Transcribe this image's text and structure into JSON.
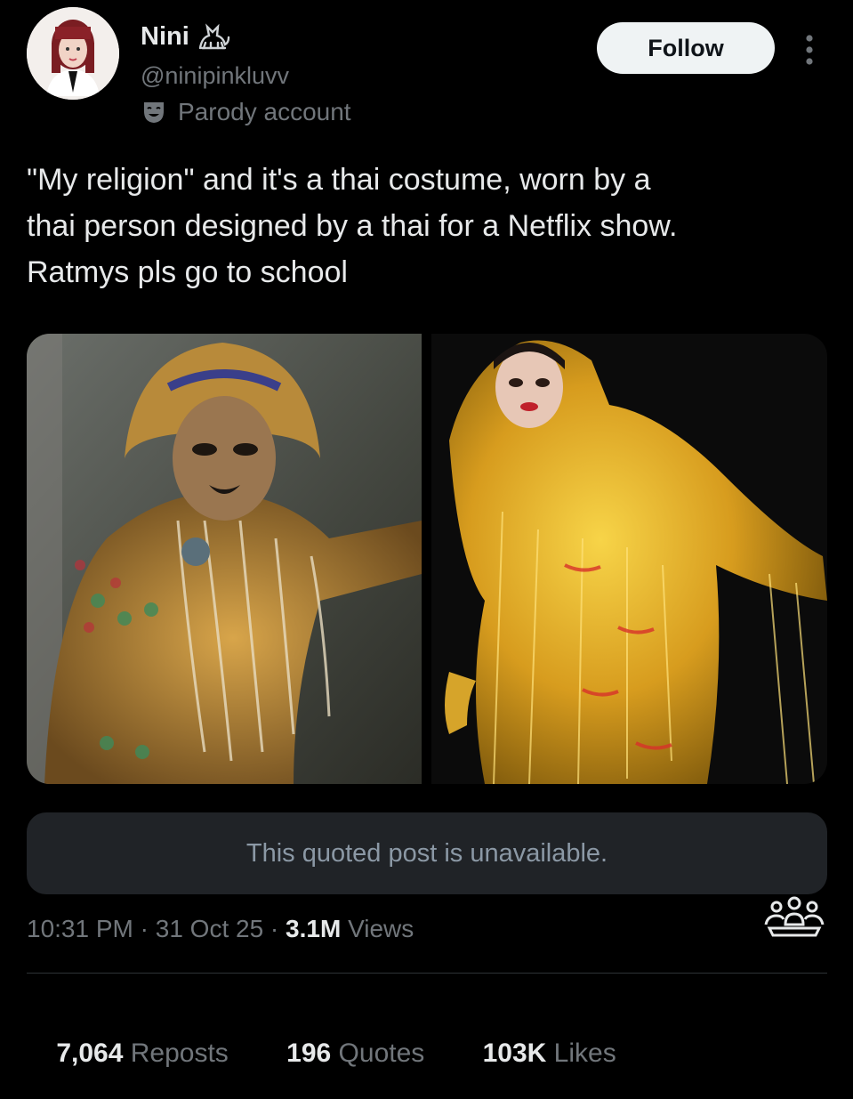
{
  "author": {
    "display_name": "Nini",
    "handle": "@ninipinkluvv",
    "badge_label": "Parody account",
    "name_emoji_icon": "black-cat-icon",
    "badge_icon": "theater-mask-icon"
  },
  "follow_label": "Follow",
  "more_icon": "vertical-ellipsis-icon",
  "tweet": {
    "text": "\"My religion\" and it's a thai costume, worn by a\nthai person designed by a thai for a Netflix show.\nRatmys pls go to school"
  },
  "media": [
    {
      "description": "Performer in gold jeweled Thai costume with pearl strands"
    },
    {
      "description": "Performer in shimmering gold beaded fringe costume"
    }
  ],
  "quoted_post": {
    "text": "This quoted post is unavailable."
  },
  "meta": {
    "time": "10:31 PM",
    "separator": " · ",
    "date": "31 Oct 25",
    "views_count": "3.1M",
    "views_label": " Views",
    "community_icon": "community-notes-icon"
  },
  "stats": [
    {
      "count": "7,064",
      "label": " Reposts"
    },
    {
      "count": "196",
      "label": " Quotes"
    },
    {
      "count": "103K",
      "label": " Likes"
    }
  ],
  "colors": {
    "background": "#000000",
    "primary_text": "#e7e9ea",
    "secondary_text": "#71767b",
    "follow_bg": "#eff3f4",
    "quoted_bg": "#202327"
  }
}
